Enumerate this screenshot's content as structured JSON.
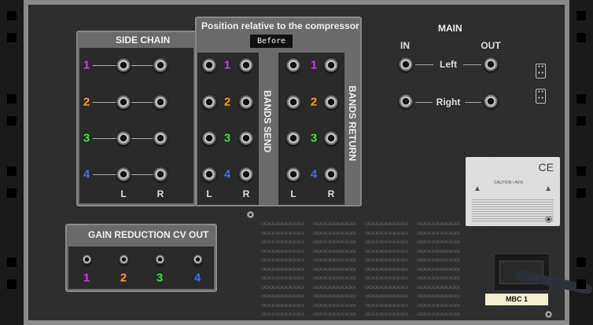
{
  "side_chain": {
    "title": "SIDE CHAIN",
    "channels": [
      "1",
      "2",
      "3",
      "4"
    ],
    "left": "L",
    "right": "R"
  },
  "position": {
    "title": "Position relative to the compressor",
    "value": "Before",
    "bands_send": "BANDS SEND",
    "bands_return": "BANDS RETURN",
    "left": "L",
    "right": "R",
    "channels": [
      "1",
      "2",
      "3",
      "4"
    ]
  },
  "main": {
    "title": "MAIN",
    "in": "IN",
    "out": "OUT",
    "left": "Left",
    "right": "Right"
  },
  "gain_reduction": {
    "title": "GAIN REDUCTION CV OUT",
    "channels": [
      "1",
      "2",
      "3",
      "4"
    ]
  },
  "sticker": {
    "caution": "CAUTION / AVIS",
    "mark": "CE"
  },
  "tape_label": "MBC 1",
  "colors": {
    "ch1": "#c53ee0",
    "ch2": "#f2a023",
    "ch3": "#3fdc3f",
    "ch4": "#3f6ff2"
  }
}
